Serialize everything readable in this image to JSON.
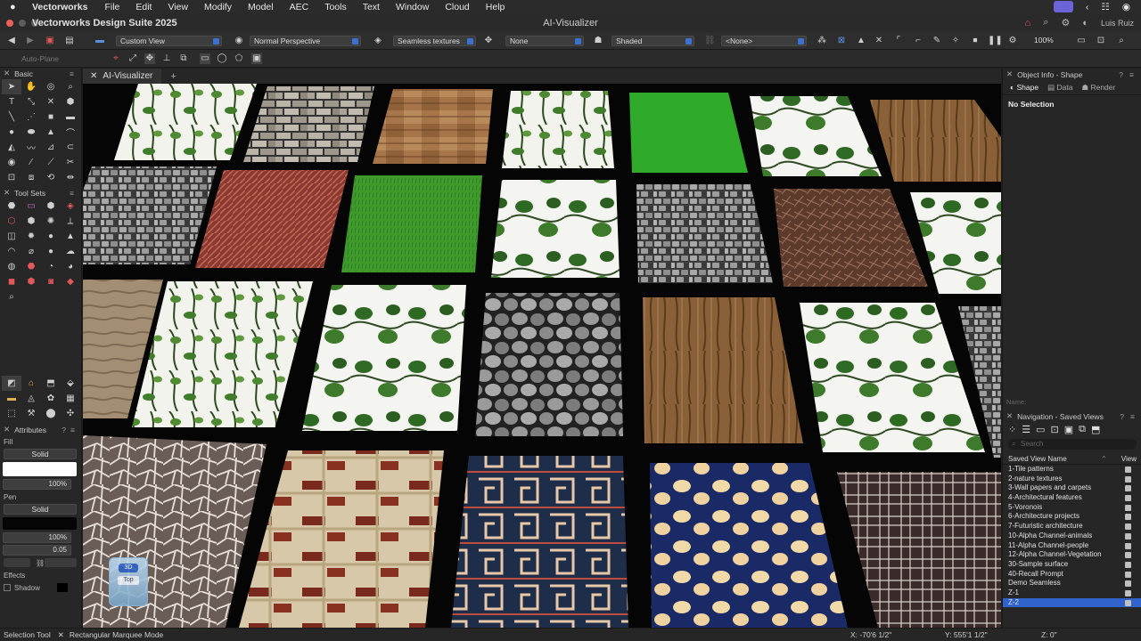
{
  "menubar": {
    "app": "Vectorworks",
    "items": [
      "File",
      "Edit",
      "View",
      "Modify",
      "Model",
      "AEC",
      "Tools",
      "Text",
      "Window",
      "Cloud",
      "Help"
    ]
  },
  "titlebar": {
    "app_title": "Vectorworks Design Suite 2025",
    "doc_title": "AI-Visualizer",
    "user": "Luis Ruiz"
  },
  "viewbar": {
    "view": "Custom View",
    "projection": "Normal Perspective",
    "textures": "Seamless textures",
    "clip": "None",
    "render": "Shaded",
    "class": "<None>",
    "zoom": "100%"
  },
  "modebar": {
    "auto_plane": "Auto-Plane"
  },
  "left": {
    "basic_title": "Basic",
    "toolsets_title": "Tool Sets",
    "attributes_title": "Attributes",
    "fill_label": "Fill",
    "fill_style": "Solid",
    "fill_opacity": "100%",
    "pen_label": "Pen",
    "pen_style": "Solid",
    "pen_opacity": "100%",
    "pen_weight": "0.05",
    "effects_label": "Effects",
    "shadow_label": "Shadow",
    "orb_top": "3D",
    "orb_mid": "Top"
  },
  "document": {
    "tab": "AI-Visualizer"
  },
  "object_info": {
    "title": "Object Info - Shape",
    "tabs": [
      "Shape",
      "Data",
      "Render"
    ],
    "status": "No Selection",
    "name_label": "Name:"
  },
  "navigation": {
    "title": "Navigation - Saved Views",
    "search_placeholder": "Search",
    "col_name": "Saved View Name",
    "col_view": "View",
    "views": [
      "1-Tile patterns",
      "2-nature textures",
      "3-Wall papers and carpets",
      "4-Architectural features",
      "5-Voronois",
      "6-Architecture projects",
      "7-Futuristic architecture",
      "10-Alpha Channel-animals",
      "11-Alpha Channel-people",
      "12-Alpha Channel-Vegetation",
      "30-Sample surface",
      "40-Recall Prompt",
      "Demo Seamless",
      "Z-1",
      "Z-2"
    ],
    "selected_index": 14
  },
  "statusbar": {
    "tool": "Selection Tool",
    "mode": "Rectangular Marquee Mode",
    "x": "X: -70'6 1/2\"",
    "y": "Y: 555'1 1/2\"",
    "z": "Z: 0\""
  },
  "colors": {
    "accent": "#2f63c9",
    "menubar_bg": "#2b2b2b",
    "panel_bg": "#272727"
  }
}
